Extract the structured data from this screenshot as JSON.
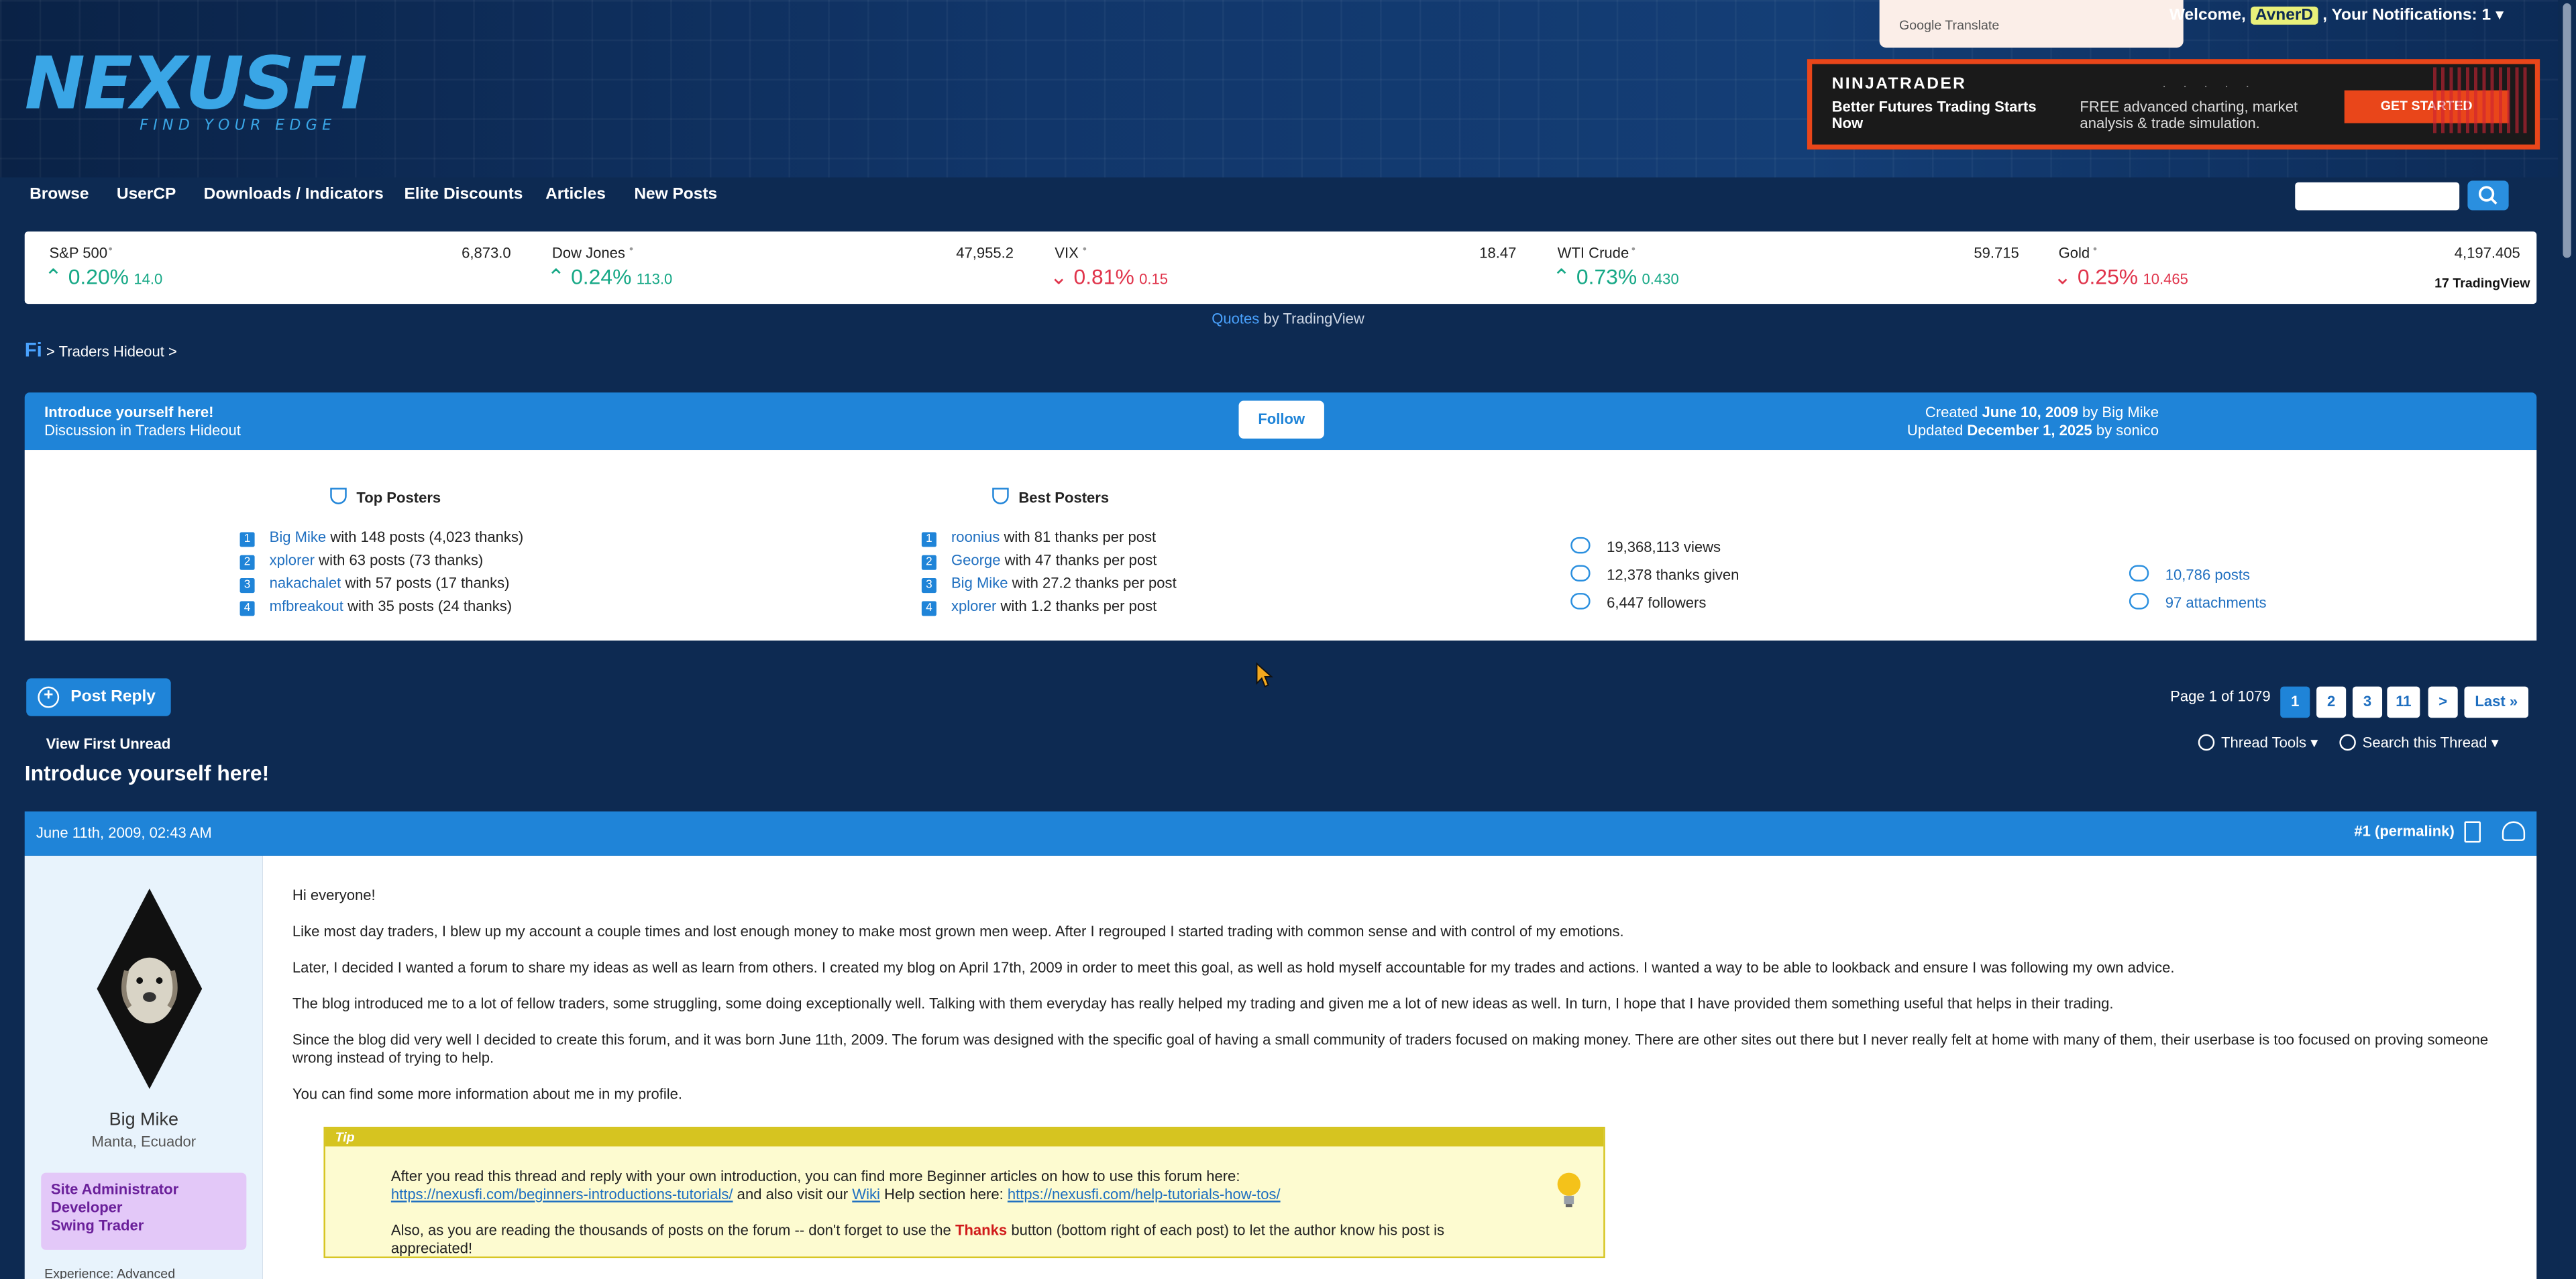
{
  "header": {
    "logo_text": "NEXUSFI",
    "logo_tagline": "FIND YOUR EDGE",
    "google_translate": "Google Translate",
    "welcome_prefix": "Welcome,",
    "username": "AvnerD",
    "notifications": "Your Notifications: 1"
  },
  "ad": {
    "brand": "NINJATRADER",
    "headline": "Better Futures Trading Starts Now",
    "description": "FREE advanced charting, market analysis & trade simulation.",
    "cta": "GET STARTED"
  },
  "nav": {
    "items": [
      "Browse",
      "UserCP",
      "Downloads / Indicators",
      "Elite Discounts",
      "Articles",
      "New Posts"
    ],
    "search_placeholder": ""
  },
  "ticker": {
    "items": [
      {
        "name": "S&P 500",
        "price": "6,873.0",
        "change_pct": "0.20%",
        "change_abs": "14.0",
        "direction": "up"
      },
      {
        "name": "Dow Jones",
        "price": "47,955.2",
        "change_pct": "0.24%",
        "change_abs": "113.0",
        "direction": "up"
      },
      {
        "name": "VIX",
        "price": "18.47",
        "change_pct": "0.81%",
        "change_abs": "0.15",
        "direction": "down"
      },
      {
        "name": "WTI Crude",
        "price": "59.715",
        "change_pct": "0.73%",
        "change_abs": "0.430",
        "direction": "up"
      },
      {
        "name": "Gold",
        "price": "4,197.405",
        "change_pct": "0.25%",
        "change_abs": "10.465",
        "direction": "down"
      }
    ],
    "tradingview_badge": "TradingView",
    "quotes_link": "Quotes",
    "quotes_suffix": "by TradingView"
  },
  "breadcrumb": {
    "home": "Fi",
    "section": "Traders Hideout",
    "sep": ">"
  },
  "thread": {
    "title": "Introduce yourself here!",
    "subtitle": "Discussion in Traders Hideout",
    "follow": "Follow",
    "created_label": "Created",
    "created_date": "June 10, 2009",
    "created_by": "by Big Mike",
    "updated_label": "Updated",
    "updated_date": "December 1, 2025",
    "updated_by": "by sonico"
  },
  "top_posters": {
    "title": "Top Posters",
    "rows": [
      {
        "rank": "1",
        "name": "Big Mike",
        "detail": "with 148 posts (4,023 thanks)"
      },
      {
        "rank": "2",
        "name": "xplorer",
        "detail": "with 63 posts (73 thanks)"
      },
      {
        "rank": "3",
        "name": "nakachalet",
        "detail": "with 57 posts (17 thanks)"
      },
      {
        "rank": "4",
        "name": "mfbreakout",
        "detail": "with 35 posts (24 thanks)"
      }
    ]
  },
  "best_posters": {
    "title": "Best Posters",
    "rows": [
      {
        "rank": "1",
        "name": "roonius",
        "detail": "with 81 thanks per post"
      },
      {
        "rank": "2",
        "name": "George",
        "detail": "with 47 thanks per post"
      },
      {
        "rank": "3",
        "name": "Big Mike",
        "detail": "with 27.2 thanks per post"
      },
      {
        "rank": "4",
        "name": "xplorer",
        "detail": "with 1.2 thanks per post"
      }
    ]
  },
  "stats": {
    "views": "19,368,113 views",
    "thanks": "12,378 thanks given",
    "followers": "6,447 followers",
    "posts": "10,786 posts",
    "attachments": "97 attachments"
  },
  "toolbar": {
    "post_reply": "Post Reply",
    "page_info": "Page 1 of 1079",
    "pages": [
      "1",
      "2",
      "3",
      "11",
      ">",
      "Last »"
    ],
    "view_first_unread": "View First Unread",
    "thread_tools": "Thread Tools",
    "search_thread": "Search this Thread"
  },
  "post": {
    "date": "June 11th, 2009, 02:43 AM",
    "permalink": "#1 (permalink)",
    "author": "Big Mike",
    "location": "Manta, Ecuador",
    "roles": [
      "Site Administrator",
      "Developer",
      "Swing Trader"
    ],
    "experience": "Experience: Advanced",
    "paragraphs": [
      "Hi everyone!",
      "Like most day traders, I blew up my account a couple times and lost enough money to make most grown men weep. After I regrouped I started trading with common sense and with control of my emotions.",
      "Later, I decided I wanted a forum to share my ideas as well as learn from others. I created my blog on April 17th, 2009 in order to meet this goal, as well as hold myself accountable for my trades and actions. I wanted a way to be able to lookback and ensure I was following my own advice.",
      "The blog introduced me to a lot of fellow traders, some struggling, some doing exceptionally well. Talking with them everyday has really helped my trading and given me a lot of new ideas as well. In turn, I hope that I have provided them something useful that helps in their trading.",
      "Since the blog did very well I decided to create this forum, and it was born June 11th, 2009. The forum was designed with the specific goal of having a small community of traders focused on making money. There are other sites out there but I never really felt at home with many of them, their userbase is too focused on proving someone wrong instead of trying to help.",
      "You can find some more information about me in my profile."
    ],
    "tip": {
      "label": "Tip",
      "line1": "After you read this thread and reply with your own introduction, you can find more Beginner articles on how to use this forum here:",
      "link1": "https://nexusfi.com/beginners-introductions-tutorials/",
      "line2a": "and also visit our",
      "wiki": "Wiki",
      "line2b": "Help section here:",
      "link2": "https://nexusfi.com/help-tutorials-how-tos/",
      "line3a": "Also, as you are reading the thousands of posts on the forum -- don't forget to use the",
      "thanks": "Thanks",
      "line3b": "button (bottom right of each post) to let the author know his post is",
      "line4": "appreciated!"
    }
  }
}
